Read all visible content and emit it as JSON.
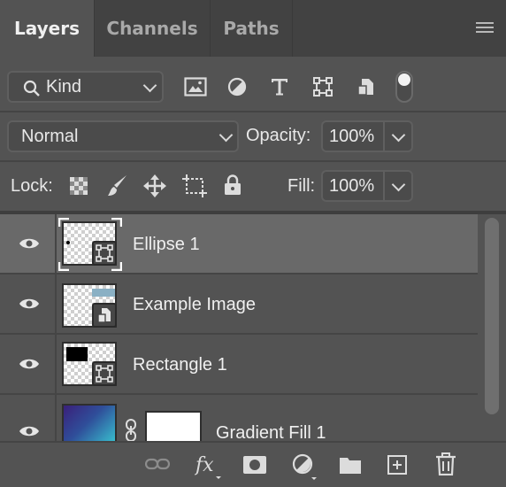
{
  "tabs": [
    {
      "label": "Layers",
      "active": true
    },
    {
      "label": "Channels",
      "active": false
    },
    {
      "label": "Paths",
      "active": false
    }
  ],
  "filter": {
    "kind_label": "Kind",
    "icons": [
      "image-filter-icon",
      "adjustment-filter-icon",
      "type-filter-icon",
      "shape-filter-icon",
      "smart-object-filter-icon",
      "filter-toggle-icon"
    ]
  },
  "blend": {
    "mode": "Normal",
    "opacity_label": "Opacity:",
    "opacity_value": "100%"
  },
  "lock": {
    "label": "Lock:",
    "fill_label": "Fill:",
    "fill_value": "100%"
  },
  "layers": [
    {
      "name": "Ellipse 1",
      "kind": "shape",
      "selected": true
    },
    {
      "name": "Example Image",
      "kind": "smart-object",
      "selected": false
    },
    {
      "name": "Rectangle 1",
      "kind": "shape",
      "selected": false
    },
    {
      "name": "Gradient Fill 1",
      "kind": "fill",
      "selected": false
    }
  ],
  "bottom_icons": [
    "link-layers-icon",
    "fx-icon",
    "mask-icon",
    "adjustment-layer-icon",
    "folder-icon",
    "new-layer-icon",
    "trash-icon"
  ],
  "colors": {
    "panel_bg": "#535353",
    "tab_bar": "#424242",
    "selected_row": "#696969",
    "gradient_start": "#3a1f7a",
    "gradient_end": "#39c8d2"
  }
}
